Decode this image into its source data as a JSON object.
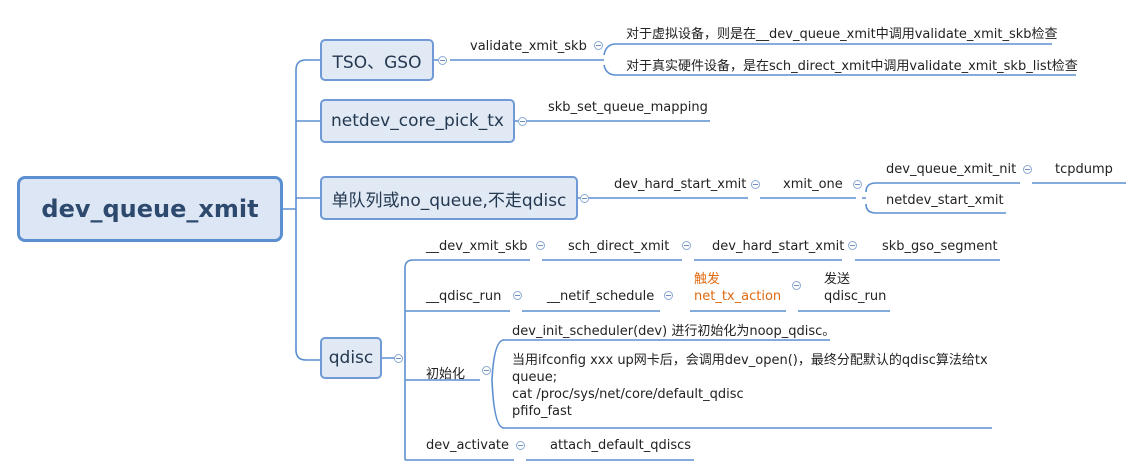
{
  "root": {
    "label": "dev_queue_xmit"
  },
  "colors": {
    "line": "#5b8fd0",
    "box_fill": "#e1e9f5",
    "root_fill": "#dce6f4",
    "text": "#222222",
    "highlight": "#e06a10"
  },
  "branches": {
    "tso": {
      "label": "TSO、GSO",
      "child": "validate_xmit_skb",
      "notes": [
        "对于虚拟设备，则是在__dev_queue_xmit中调用validate_xmit_skb检查",
        "对于真实硬件设备，是在sch_direct_xmit中调用validate_xmit_skb_list检查"
      ]
    },
    "pick_tx": {
      "label": "netdev_core_pick_tx",
      "child": "skb_set_queue_mapping"
    },
    "no_queue": {
      "label": "单队列或no_queue,不走qdisc",
      "child": "dev_hard_start_xmit",
      "grandchild": "xmit_one",
      "leaves": [
        "dev_queue_xmit_nit",
        "netdev_start_xmit"
      ],
      "leaf_child": "tcpdump"
    },
    "qdisc": {
      "label": "qdisc",
      "path1": [
        "__dev_xmit_skb",
        "sch_direct_xmit",
        "dev_hard_start_xmit",
        "skb_gso_segment"
      ],
      "path2": {
        "items": [
          "__qdisc_run",
          "__netif_schedule"
        ],
        "trigger_line1": "触发",
        "trigger_line2": "net_tx_action",
        "send_line1": "发送",
        "send_line2": "qdisc_run"
      },
      "init": {
        "label": "初始化",
        "note1": "dev_init_scheduler(dev) 进行初始化为noop_qdisc。",
        "note2_lines": [
          "当用ifconfig xxx up网卡后，会调用dev_open()，最终分配默认的qdisc算法给tx",
          "queue;",
          "cat /proc/sys/net/core/default_qdisc",
          "pfifo_fast"
        ]
      },
      "activate": {
        "label": "dev_activate",
        "child": "attach_default_qdiscs"
      }
    }
  }
}
